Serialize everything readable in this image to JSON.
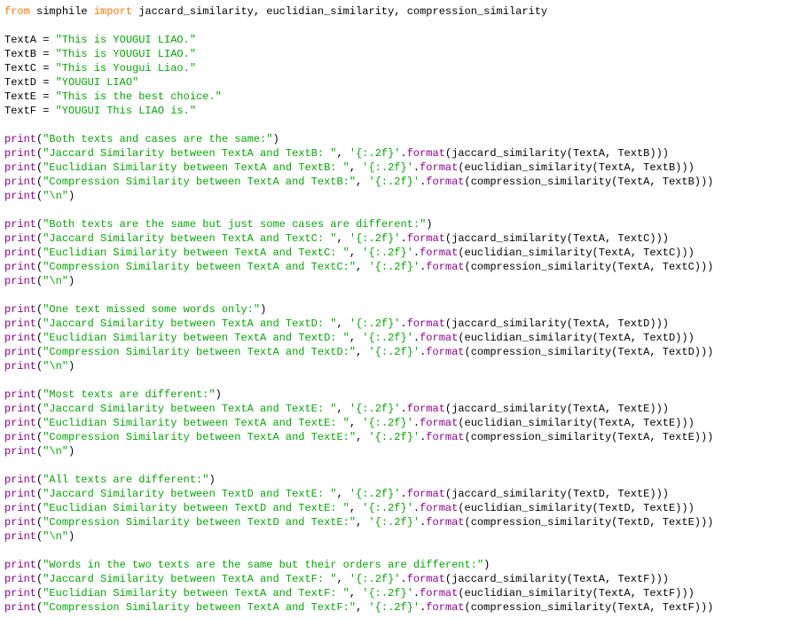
{
  "kw_from": "from",
  "mod": " simphile ",
  "kw_import": "import",
  "imports": " jaccard_similarity, euclidian_similarity, compression_similarity",
  "assignA_l": "TextA = ",
  "assignA_s": "\"This is YOUGUI LIAO.\"",
  "assignB_l": "TextB = ",
  "assignB_s": "\"This is YOUGUI LIAO.\"",
  "assignC_l": "TextC = ",
  "assignC_s": "\"This is Yougui Liao.\"",
  "assignD_l": "TextD = ",
  "assignD_s": "\"YOUGUI LIAO\"",
  "assignE_l": "TextE = ",
  "assignE_s": "\"This is the best choice.\"",
  "assignF_l": "TextF = ",
  "assignF_s": "\"YOUGUI This LIAO is.\"",
  "fn_print": "print",
  "lpar": "(",
  "rpar": ")",
  "comma_sp": ", ",
  "dot": ".",
  "format_call": "format",
  "jac": "jaccard_similarity",
  "euc": "euclidian_similarity",
  "cmp": "compression_similarity",
  "fmt_str": "'{:.2f}'",
  "nl_str": "\"\\n\"",
  "blk1_h": "\"Both texts and cases are the same:\"",
  "blk1_j": "\"Jaccard Similarity between TextA and TextB: \"",
  "blk1_e": "\"Euclidian Similarity between TextA and TextB: \"",
  "blk1_c": "\"Compression Similarity between TextA and TextB:\"",
  "blk1_args": "(TextA, TextB)))",
  "blk2_h": "\"Both texts are the same but just some cases are different:\"",
  "blk2_j": "\"Jaccard Similarity between TextA and TextC: \"",
  "blk2_e": "\"Euclidian Similarity between TextA and TextC: \"",
  "blk2_c": "\"Compression Similarity between TextA and TextC:\"",
  "blk2_args": "(TextA, TextC)))",
  "blk3_h": "\"One text missed some words only:\"",
  "blk3_j": "\"Jaccard Similarity between TextA and TextD: \"",
  "blk3_e": "\"Euclidian Similarity between TextA and TextD: \"",
  "blk3_c": "\"Compression Similarity between TextA and TextD:\"",
  "blk3_args": "(TextA, TextD)))",
  "blk4_h": "\"Most texts are different:\"",
  "blk4_j": "\"Jaccard Similarity between TextA and TextE: \"",
  "blk4_e": "\"Euclidian Similarity between TextA and TextE: \"",
  "blk4_c": "\"Compression Similarity between TextA and TextE:\"",
  "blk4_args": "(TextA, TextE)))",
  "blk5_h": "\"All texts are different:\"",
  "blk5_j": "\"Jaccard Similarity between TextD and TextE: \"",
  "blk5_e": "\"Euclidian Similarity between TextD and TextE: \"",
  "blk5_c": "\"Compression Similarity between TextD and TextE:\"",
  "blk5_args": "(TextD, TextE)))",
  "blk6_h": "\"Words in the two texts are the same but their orders are different:\"",
  "blk6_j": "\"Jaccard Similarity between TextA and TextF: \"",
  "blk6_e": "\"Euclidian Similarity between TextA and TextF: \"",
  "blk6_c": "\"Compression Similarity between TextA and TextF:\"",
  "blk6_args": "(TextA, TextF)))"
}
